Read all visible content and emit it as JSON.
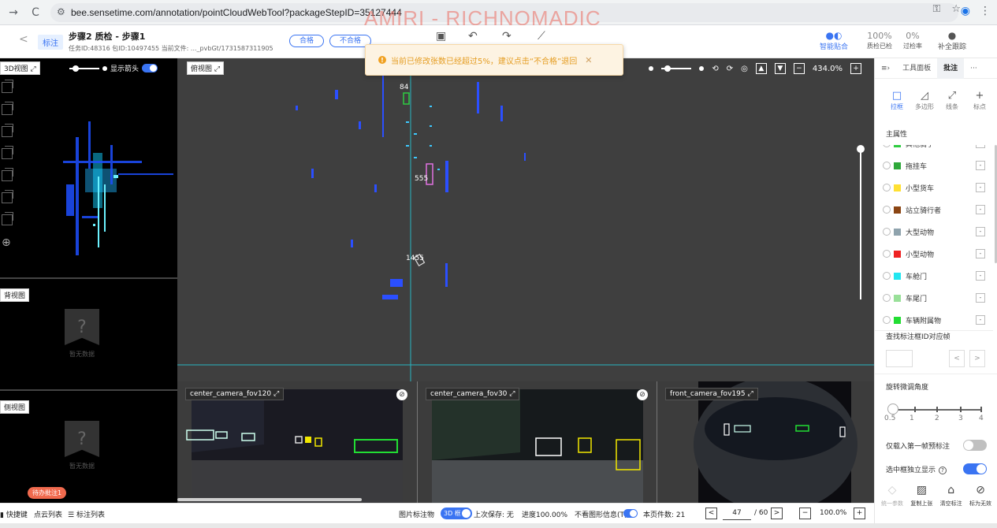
{
  "browser": {
    "url": "bee.sensetime.com/annotation/pointCloudWebTool?packageStepID=35127444",
    "watermark": "AMIRI - RICHNOMADIC"
  },
  "header": {
    "tag": "标注",
    "title": "步骤2 质检 - 步骤1",
    "meta": "任务ID:48316  包ID:10497455  当前文件: ..._pvbGt/1731587311905",
    "pass_label": "合格",
    "fail_label": "不合格",
    "ai_fit_label": "智能贴合",
    "qc_checked": {
      "value": "100%",
      "label": "质检已检"
    },
    "pass_rate": {
      "value": "0%",
      "label": "过检率"
    },
    "trace_label": "补全跟踪"
  },
  "toast": {
    "message": "当前已修改张数已经超过5%，建议点击“不合格”退回"
  },
  "left": {
    "view3d_label": "3D视图",
    "show_arrow_label": "显示箭头",
    "back_view_label": "背视图",
    "side_view_label": "侧视图",
    "no_data": "暂无数据",
    "todo_badge": "待办批注1"
  },
  "main": {
    "top_view_label": "俯视图",
    "zoom": "434.0%",
    "objects": [
      {
        "id_label": "555"
      },
      {
        "id_label": "1455"
      },
      {
        "id_label": "84"
      }
    ]
  },
  "cameras": [
    {
      "label": "center_camera_fov120"
    },
    {
      "label": "center_camera_fov30"
    },
    {
      "label": "front_camera_fov195"
    }
  ],
  "right": {
    "tabs": [
      "工具面板",
      "批注"
    ],
    "tools": [
      "拉框",
      "多边形",
      "线条",
      "标点"
    ],
    "main_attr_title": "主属性",
    "attrs": [
      {
        "name": "其他骑手",
        "color": "#2ecc40"
      },
      {
        "name": "拖挂车",
        "color": "#2ea83a"
      },
      {
        "name": "小型货车",
        "color": "#ffe033"
      },
      {
        "name": "站立骑行者",
        "color": "#8b4513"
      },
      {
        "name": "大型动物",
        "color": "#8fa3ad"
      },
      {
        "name": "小型动物",
        "color": "#ee2222"
      },
      {
        "name": "车舱门",
        "color": "#22e6f0"
      },
      {
        "name": "车尾门",
        "color": "#99e099"
      },
      {
        "name": "车辆附属物",
        "color": "#22dd33"
      }
    ],
    "find_label": "查找标注框ID对应帧",
    "rotation_title": "旋转微调角度",
    "rotation_value": 0.5,
    "rotation_labels": [
      "0.5",
      "1",
      "2",
      "3",
      "4"
    ],
    "opt_first_frame": "仅载入第一帧预标注",
    "opt_isolate": "选中框独立显示",
    "actions": [
      "统一参数",
      "复制上张",
      "清空标注",
      "标为无效"
    ]
  },
  "status": {
    "shortcut": "快捷键",
    "point_list": "点云列表",
    "label_list": "标注列表",
    "image_objects": "图片标注物",
    "pill_3d": "3D 框",
    "last_save": "上次保存: 无",
    "progress": "进度100.00%",
    "hide_graphic": "不看图形信息(T)",
    "page_count": "本页件数: 21",
    "page_current": "47",
    "page_total": "/ 60",
    "zoom": "100.0%"
  }
}
